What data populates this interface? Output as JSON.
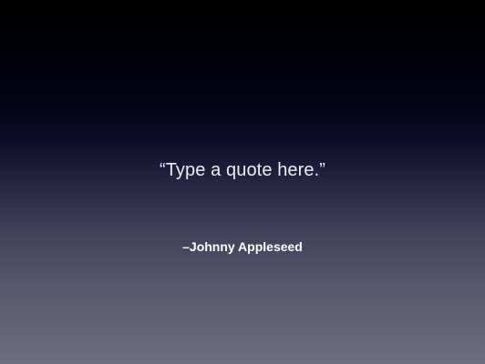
{
  "slide": {
    "quote": "“Type a quote here.”",
    "attribution": "–Johnny Appleseed"
  }
}
